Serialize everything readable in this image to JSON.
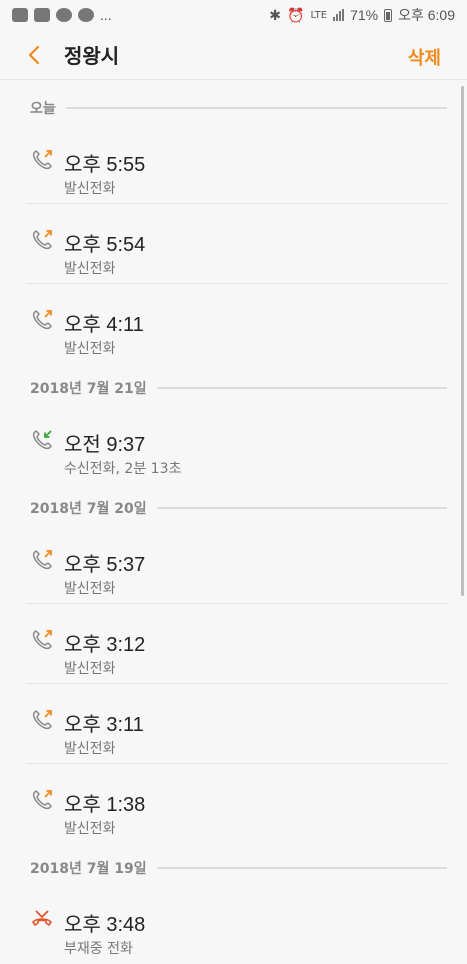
{
  "status_bar": {
    "left_dots": "...",
    "lte": "LTE",
    "battery": "71%",
    "time": "오후 6:09"
  },
  "header": {
    "title": "정왕시",
    "delete_label": "삭제"
  },
  "sections": [
    {
      "label": "오늘",
      "items": [
        {
          "time": "오후 5:55",
          "desc": "발신전화",
          "type": "outgoing"
        },
        {
          "time": "오후 5:54",
          "desc": "발신전화",
          "type": "outgoing"
        },
        {
          "time": "오후 4:11",
          "desc": "발신전화",
          "type": "outgoing"
        }
      ]
    },
    {
      "label": "2018년 7월 21일",
      "items": [
        {
          "time": "오전 9:37",
          "desc": "수신전화, 2분 13초",
          "type": "incoming"
        }
      ]
    },
    {
      "label": "2018년 7월 20일",
      "items": [
        {
          "time": "오후 5:37",
          "desc": "발신전화",
          "type": "outgoing"
        },
        {
          "time": "오후 3:12",
          "desc": "발신전화",
          "type": "outgoing"
        },
        {
          "time": "오후 3:11",
          "desc": "발신전화",
          "type": "outgoing"
        },
        {
          "time": "오후 1:38",
          "desc": "발신전화",
          "type": "outgoing"
        }
      ]
    },
    {
      "label": "2018년 7월 19일",
      "items": [
        {
          "time": "오후 3:48",
          "desc": "부재중 전화",
          "type": "missed"
        }
      ]
    }
  ],
  "colors": {
    "accent": "#f08a1c",
    "outgoing_arrow": "#f08a1c",
    "incoming_arrow": "#3aa43a",
    "missed": "#e0562a"
  }
}
